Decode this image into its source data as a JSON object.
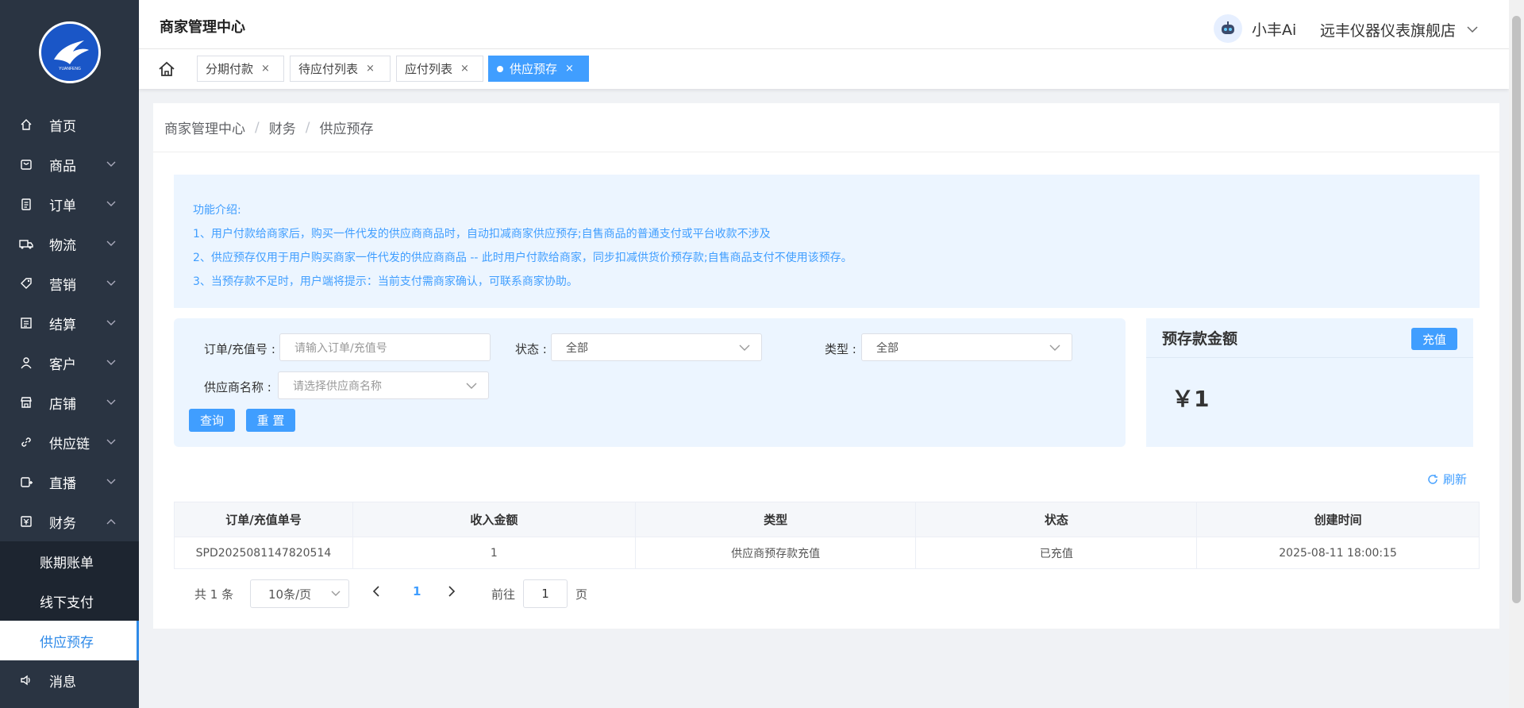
{
  "sidebar": {
    "logo_text": "YUANFENG",
    "items": [
      {
        "label": "首页",
        "icon": "home-icon",
        "arrow": false
      },
      {
        "label": "商品",
        "icon": "bag-icon",
        "arrow": true
      },
      {
        "label": "订单",
        "icon": "clipboard-icon",
        "arrow": true
      },
      {
        "label": "物流",
        "icon": "truck-icon",
        "arrow": true
      },
      {
        "label": "营销",
        "icon": "tag-icon",
        "arrow": true
      },
      {
        "label": "结算",
        "icon": "document-icon",
        "arrow": true
      },
      {
        "label": "客户",
        "icon": "user-icon",
        "arrow": true
      },
      {
        "label": "店铺",
        "icon": "shop-icon",
        "arrow": true
      },
      {
        "label": "供应链",
        "icon": "link-icon",
        "arrow": true
      },
      {
        "label": "直播",
        "icon": "live-icon",
        "arrow": true
      },
      {
        "label": "财务",
        "icon": "finance-icon",
        "arrow": true,
        "expanded": true
      }
    ],
    "finance_sub": [
      {
        "label": "账期账单"
      },
      {
        "label": "线下支付"
      },
      {
        "label": "供应预存",
        "active": true
      }
    ],
    "message": {
      "label": "消息",
      "icon": "speaker-icon"
    }
  },
  "header": {
    "title": "商家管理中心",
    "ai_label": "小丰Ai",
    "store_name": "远丰仪器仪表旗舰店"
  },
  "tabs": [
    {
      "label": "分期付款"
    },
    {
      "label": "待应付列表"
    },
    {
      "label": "应付列表"
    },
    {
      "label": "供应预存",
      "active": true
    }
  ],
  "breadcrumb": {
    "items": [
      "商家管理中心",
      "财务",
      "供应预存"
    ],
    "separator": "/"
  },
  "intro": {
    "title": "功能介绍:",
    "lines": [
      "1、用户付款给商家后，购买一件代发的供应商商品时，自动扣减商家供应预存;自售商品的普通支付或平台收款不涉及",
      "2、供应预存仅用于用户购买商家一件代发的供应商商品 -- 此时用户付款给商家，同步扣减供货价预存款;自售商品支付不使用该预存。",
      "3、当预存款不足时，用户端将提示：当前支付需商家确认，可联系商家协助。"
    ]
  },
  "filter": {
    "order_label": "订单/充值号 :",
    "order_placeholder": "请输入订单/充值号",
    "status_label": "状态 :",
    "status_value": "全部",
    "type_label": "类型 :",
    "type_value": "全部",
    "supplier_label": "供应商名称 :",
    "supplier_placeholder": "请选择供应商名称",
    "query_label": "查询",
    "reset_label": "重 置"
  },
  "prestore": {
    "title": "预存款金额",
    "recharge_label": "充值",
    "amount": "￥1"
  },
  "refresh_label": "刷新",
  "table": {
    "columns": [
      "订单/充值单号",
      "收入金额",
      "类型",
      "状态",
      "创建时间"
    ],
    "rows": [
      [
        "SPD2025081147820514",
        "1",
        "供应商预存款充值",
        "已充值",
        "2025-08-11 18:00:15"
      ]
    ]
  },
  "pager": {
    "total": "共 1 条",
    "page_size": "10条/页",
    "current": "1",
    "goto_label": "前往",
    "goto_value": "1",
    "page_label": "页"
  },
  "colors": {
    "sidebar_bg": "#2a3442",
    "accent": "#409eff",
    "panel_bg": "#ecf5ff"
  }
}
